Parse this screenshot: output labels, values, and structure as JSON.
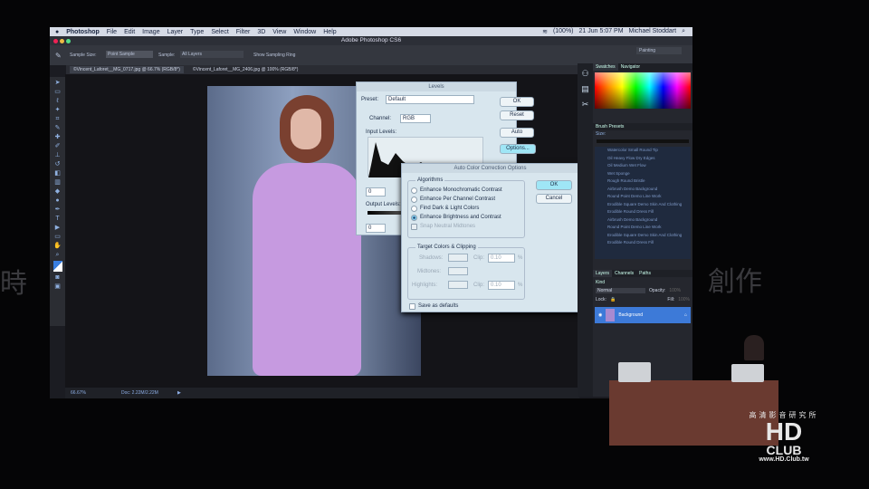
{
  "stage": {
    "left_text": "時",
    "right_text": "創作"
  },
  "menubar": {
    "apple": "",
    "items": [
      "Photoshop",
      "File",
      "Edit",
      "Image",
      "Layer",
      "Type",
      "Select",
      "Filter",
      "3D",
      "View",
      "Window",
      "Help"
    ],
    "battery": "(100%)",
    "datetime": "21 Jun  5:07 PM",
    "user": "Michael Stoddart"
  },
  "window_title": "Adobe Photoshop CS6",
  "workspace": "Painting",
  "options_bar": {
    "sample_size_label": "Sample Size:",
    "sample_size_value": "Point Sample",
    "sample_label": "Sample:",
    "sample_value": "All Layers",
    "sampling_ring": "Show Sampling Ring"
  },
  "tabs": [
    "©Vincent_Laforet__MG_0717.jpg @ 66.7% (RGB/8*)",
    "©Vincent_Laforet__MG_2406.jpg @ 100% (RGB/8*)"
  ],
  "status": {
    "zoom": "66.67%",
    "doc": "Doc: 2.22M/2.22M"
  },
  "levels": {
    "title": "Levels",
    "preset_label": "Preset:",
    "preset_value": "Default",
    "channel_label": "Channel:",
    "channel_value": "RGB",
    "input_levels": "Input Levels:",
    "input_min": "0",
    "output_levels": "Output Levels:",
    "output_min": "0",
    "ok": "OK",
    "reset": "Reset",
    "auto": "Auto",
    "options": "Options..."
  },
  "auto_color": {
    "title": "Auto Color Correction Options",
    "algorithms": "Algorithms",
    "options": [
      {
        "label": "Enhance Monochromatic Contrast",
        "selected": false
      },
      {
        "label": "Enhance Per Channel Contrast",
        "selected": false
      },
      {
        "label": "Find Dark & Light Colors",
        "selected": false
      },
      {
        "label": "Enhance Brightness and Contrast",
        "selected": true
      }
    ],
    "snap": "Snap Neutral Midtones",
    "target": "Target Colors & Clipping",
    "shadows": "Shadows:",
    "midtones": "Midtones:",
    "highlights": "Highlights:",
    "clip_label": "Clip:",
    "clip_shadows": "0.10",
    "clip_highlights": "0.10",
    "percent": "%",
    "save_defaults": "Save as defaults",
    "ok": "OK",
    "cancel": "Cancel"
  },
  "panels": {
    "swatches_tabs": [
      "Swatches",
      "Navigator"
    ],
    "brush_title": "Brush Presets",
    "size_label": "Size:",
    "brushes": [
      "Watercolor Small Round Tip",
      "Oil Heavy Flow Dry Edges",
      "Oil Medium Wet Flow",
      "Wet Sponge",
      "Rough Round Bristle",
      "Airbrush Demo Background",
      "Round Point Demo Line Work",
      "Erodible Square Demo Skin And Clothing",
      "Erodible Round Dress Fill",
      "Airbrush Demo Background",
      "Round Point Demo Line Work",
      "Erodible Square Demo Skin And Clothing",
      "Erodible Round Dress Fill"
    ],
    "layer_tabs": [
      "Layers",
      "Channels",
      "Paths"
    ],
    "kind": "Kind",
    "blend": "Normal",
    "opacity_label": "Opacity:",
    "opacity": "100%",
    "lock_label": "Lock:",
    "fill_label": "Fill:",
    "fill": "100%",
    "layer_name": "Background"
  },
  "logo": {
    "top": "高清影音研究所",
    "main": "HD",
    "sub": "CLUB",
    "url": "www.HD.Club.tw"
  }
}
